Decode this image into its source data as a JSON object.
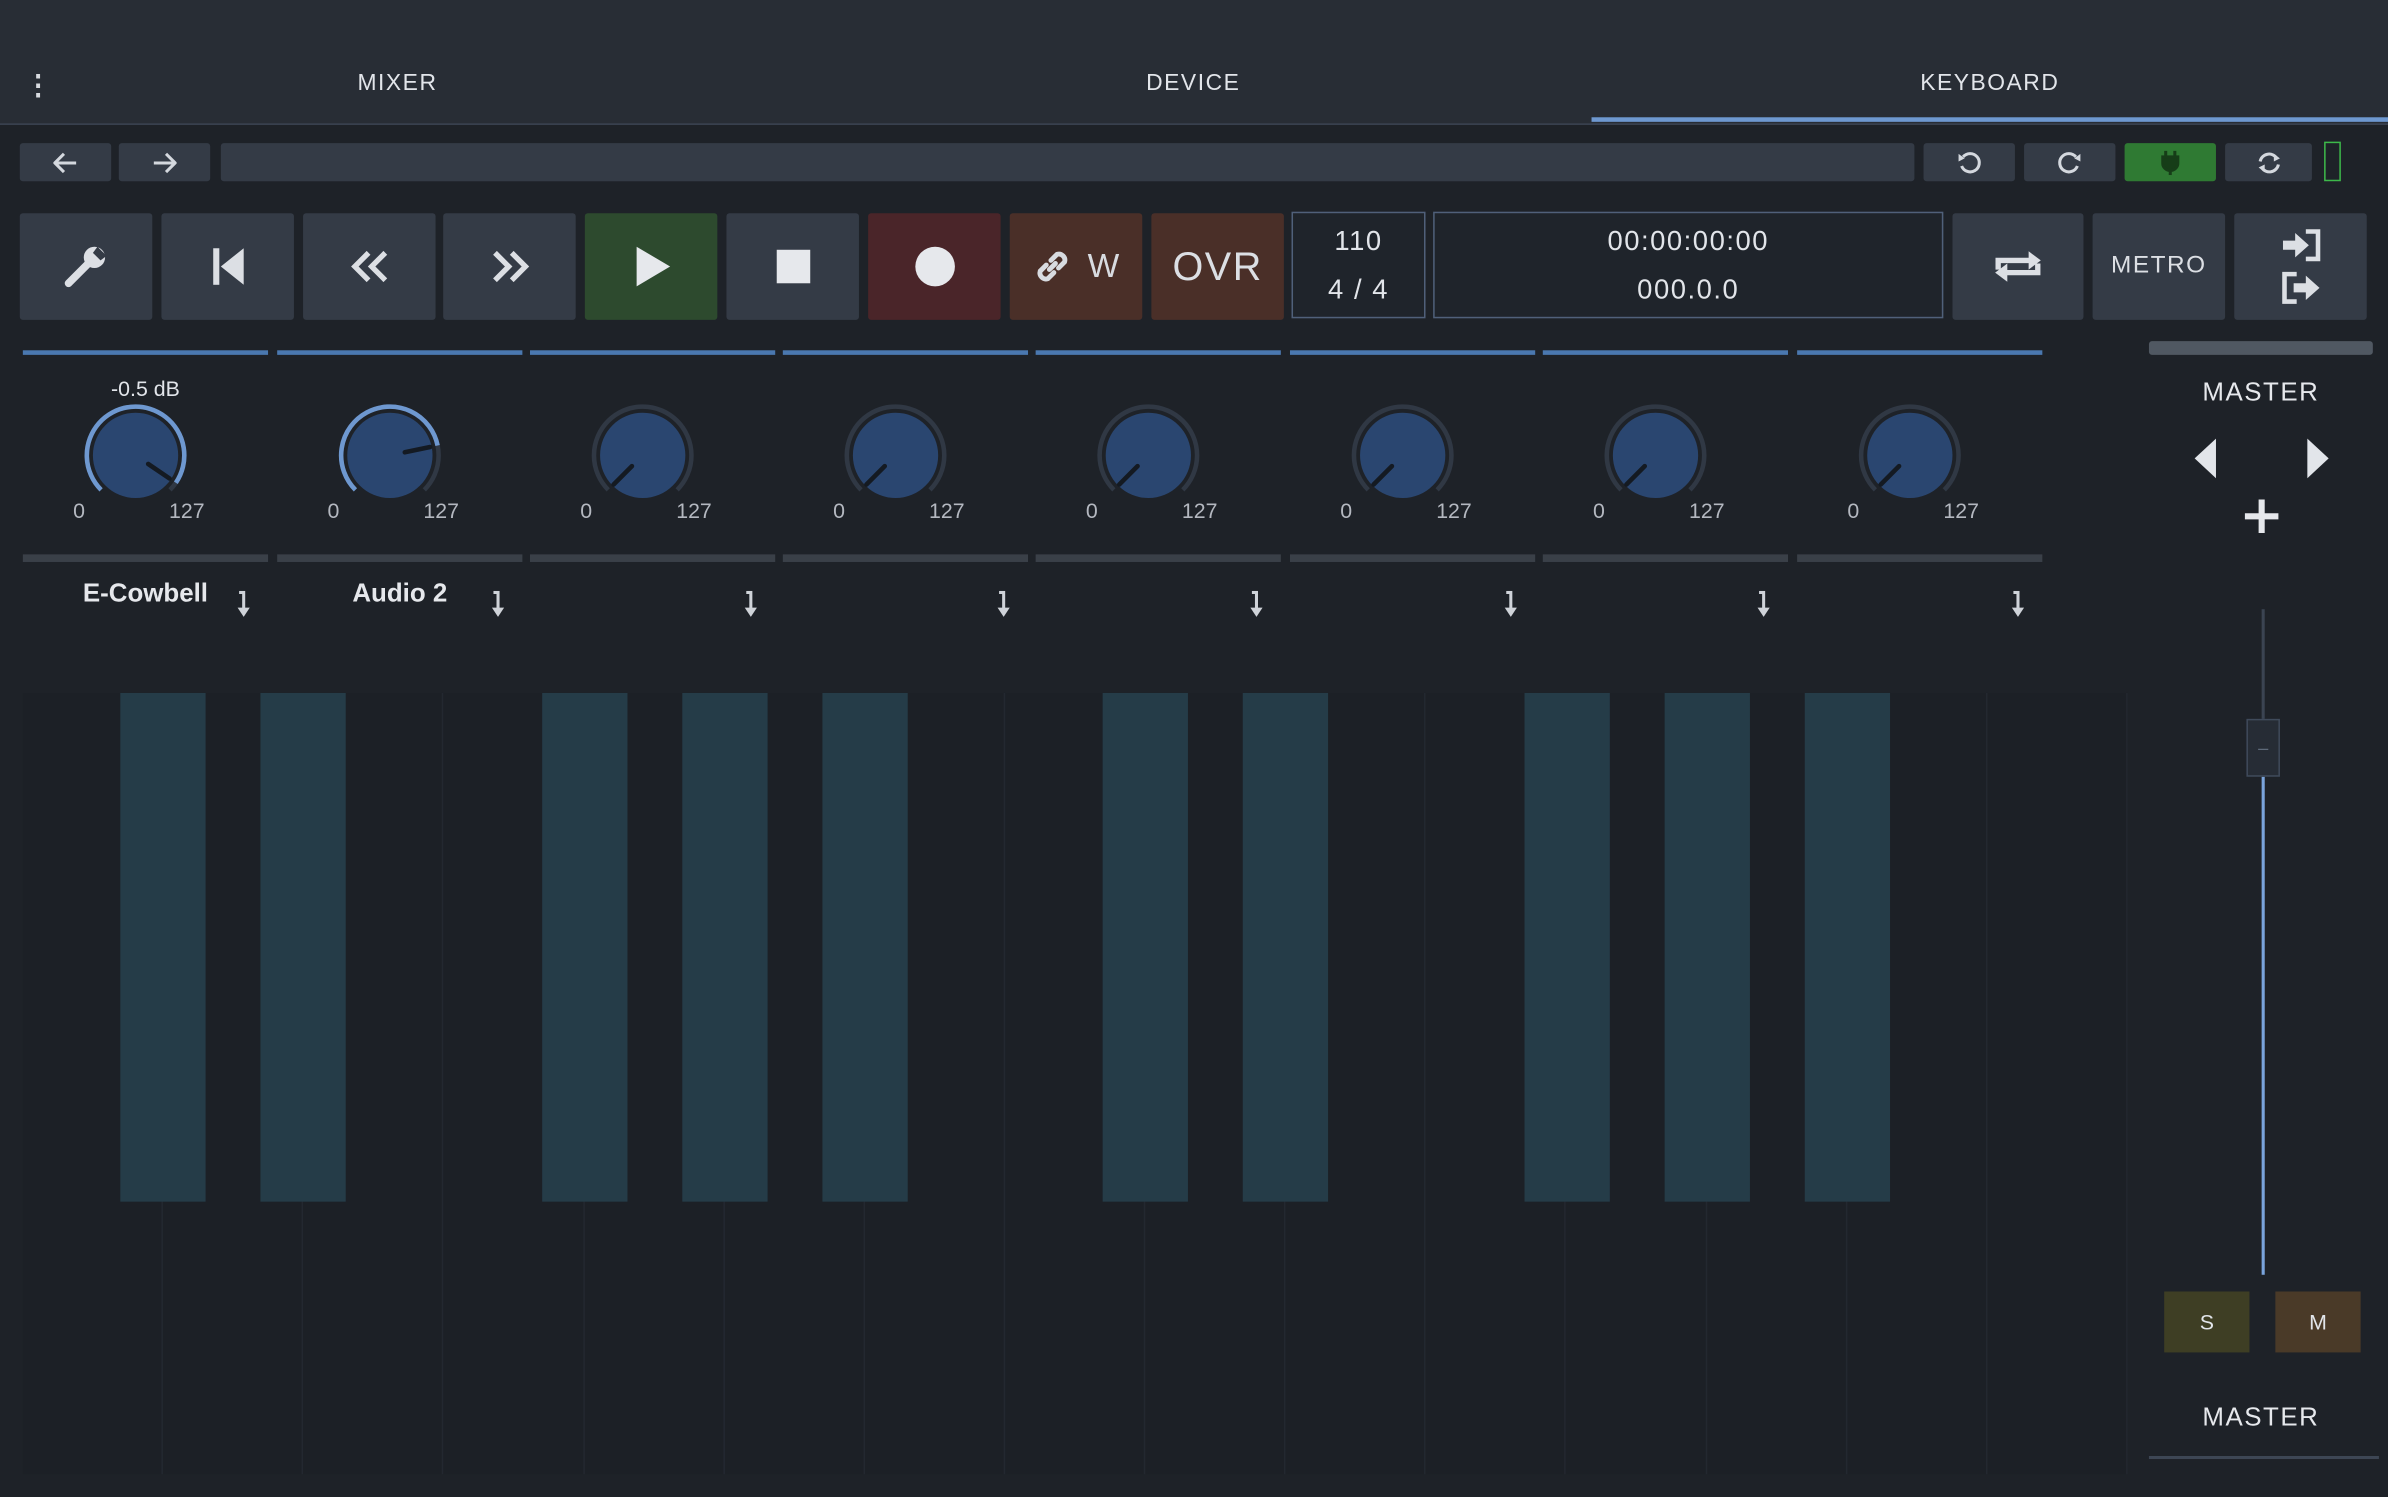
{
  "tabs": [
    {
      "label": "MIXER",
      "active": false
    },
    {
      "label": "DEVICE",
      "active": false
    },
    {
      "label": "KEYBOARD",
      "active": true
    }
  ],
  "menu_icon": "kebab-menu-icon",
  "toolbar": {
    "back_icon": "arrow-left-icon",
    "forward_icon": "arrow-right-icon",
    "undo_icon": "undo-icon",
    "redo_icon": "redo-icon",
    "connection_icon": "plug-icon",
    "connection_color": "#2f7a33",
    "refresh_icon": "refresh-icon",
    "meter_color": "#3db84a"
  },
  "transport": {
    "settings_icon": "wrench-icon",
    "skip_start_icon": "skip-to-start-icon",
    "rewind_icon": "rewind-icon",
    "forward_icon": "fast-forward-icon",
    "play_icon": "play-icon",
    "stop_icon": "stop-icon",
    "record_icon": "record-icon",
    "link_label": "W",
    "overdub_label": "OVR",
    "tempo": "110",
    "time_signature": "4 / 4",
    "time_display": "00:00:00:00",
    "beat_display": "000.0.0",
    "loop_icon": "loop-icon",
    "metro_label": "METRO",
    "io_icons": [
      "sign-in-icon",
      "sign-out-icon"
    ]
  },
  "strips": [
    {
      "name": "E-Cowbell",
      "value_label": "-0.5 dB",
      "min": "0",
      "max": "127",
      "level": 0.96
    },
    {
      "name": "Audio 2",
      "value_label": "",
      "min": "0",
      "max": "127",
      "level": 0.79
    },
    {
      "name": "",
      "value_label": "",
      "min": "0",
      "max": "127",
      "level": 0
    },
    {
      "name": "",
      "value_label": "",
      "min": "0",
      "max": "127",
      "level": 0
    },
    {
      "name": "",
      "value_label": "",
      "min": "0",
      "max": "127",
      "level": 0
    },
    {
      "name": "",
      "value_label": "",
      "min": "0",
      "max": "127",
      "level": 0
    },
    {
      "name": "",
      "value_label": "",
      "min": "0",
      "max": "127",
      "level": 0
    },
    {
      "name": "",
      "value_label": "",
      "min": "0",
      "max": "127",
      "level": 0
    }
  ],
  "master": {
    "title": "MASTER",
    "footer": "MASTER",
    "solo_label": "S",
    "mute_label": "M",
    "solo_color": "#3e3e24",
    "mute_color": "#4a3a28",
    "fader_level": 0.75
  },
  "keyboard": {
    "white_keys": 15,
    "black_keys": [
      {
        "note": "C#"
      },
      {
        "note": "D#"
      },
      {
        "note": "F#"
      },
      {
        "note": "G#"
      },
      {
        "note": "A#"
      },
      {
        "note": "C#"
      },
      {
        "note": "D#"
      },
      {
        "note": "F#"
      },
      {
        "note": "G#"
      },
      {
        "note": "A#"
      }
    ]
  }
}
